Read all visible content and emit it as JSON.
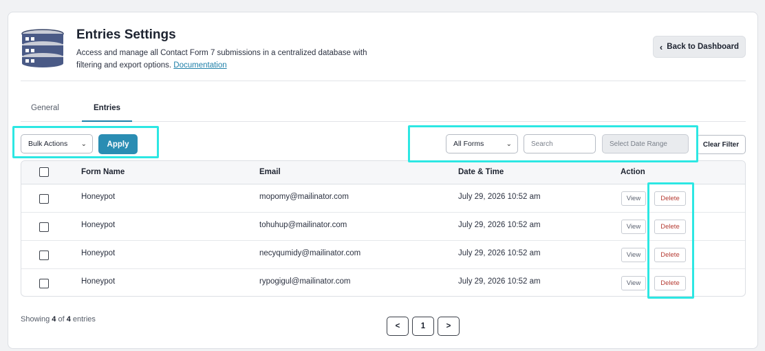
{
  "header": {
    "title": "Entries Settings",
    "description": "Access and manage all Contact Form 7 submissions in a centralized database with filtering and export options.",
    "doc_link": "Documentation",
    "back_label": "Back to Dashboard",
    "icon": "database-icon"
  },
  "tabs": [
    {
      "label": "General",
      "active": false
    },
    {
      "label": "Entries",
      "active": true
    }
  ],
  "toolbar": {
    "bulk_actions": "Bulk Actions",
    "apply": "Apply",
    "forms_filter": "All Forms",
    "search_placeholder": "Search",
    "date_placeholder": "Select Date Range",
    "clear_filter": "Clear Filter"
  },
  "table": {
    "columns": [
      "Form Name",
      "Email",
      "Date & Time",
      "Action"
    ],
    "rows": [
      {
        "form": "Honeypot",
        "email": "mopomy@mailinator.com",
        "date": "July 29, 2026 10:52 am",
        "view": "View",
        "delete": "Delete"
      },
      {
        "form": "Honeypot",
        "email": "tohuhup@mailinator.com",
        "date": "July 29, 2026 10:52 am",
        "view": "View",
        "delete": "Delete"
      },
      {
        "form": "Honeypot",
        "email": "necyqumidy@mailinator.com",
        "date": "July 29, 2026 10:52 am",
        "view": "View",
        "delete": "Delete"
      },
      {
        "form": "Honeypot",
        "email": "rypogigul@mailinator.com",
        "date": "July 29, 2026 10:52 am",
        "view": "View",
        "delete": "Delete"
      }
    ]
  },
  "footer": {
    "showing_prefix": "Showing",
    "shown": "4",
    "of_word": "of",
    "total": "4",
    "suffix": "entries",
    "prev": "<",
    "page": "1",
    "next": ">"
  },
  "colors": {
    "accent": "#2a8db3",
    "highlight": "#2ce7e3",
    "delete_text": "#b53b33"
  }
}
